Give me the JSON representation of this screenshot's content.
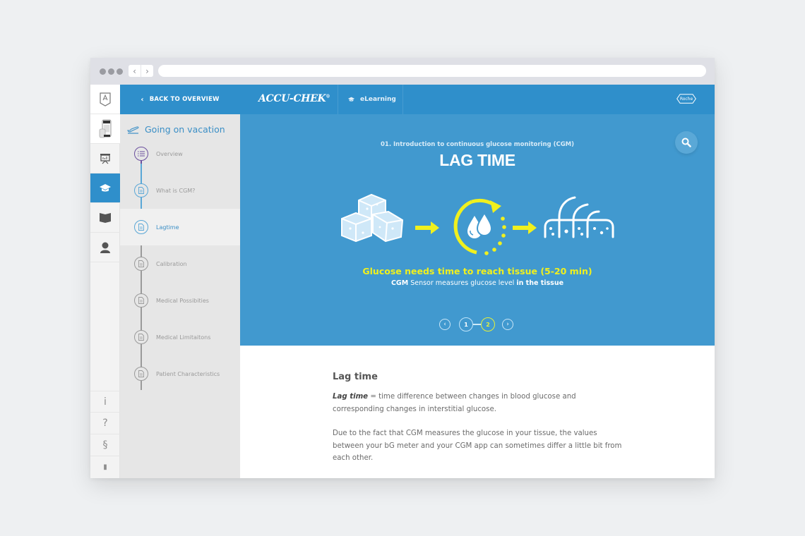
{
  "browser": {
    "back_glyph": "‹",
    "forward_glyph": "›",
    "url": ""
  },
  "rail": {
    "items": [
      {
        "name": "badge",
        "icon": "badge-icon"
      },
      {
        "name": "devices",
        "icon": "devices-icon"
      },
      {
        "name": "presentation",
        "icon": "presentation-icon"
      },
      {
        "name": "elearning",
        "icon": "graduation-cap-icon",
        "active": true
      },
      {
        "name": "book",
        "icon": "book-icon"
      },
      {
        "name": "profile",
        "icon": "user-icon"
      }
    ],
    "bottom": [
      {
        "name": "info",
        "glyph": "i"
      },
      {
        "name": "help",
        "glyph": "?"
      },
      {
        "name": "legal",
        "glyph": "§"
      },
      {
        "name": "logout",
        "glyph": "▮"
      }
    ]
  },
  "nav": {
    "back_label": "BACK TO OVERVIEW",
    "course_title": "Going on vacation",
    "items": [
      {
        "label": "Overview",
        "state": "current"
      },
      {
        "label": "What is CGM?",
        "state": "done"
      },
      {
        "label": "Lagtime",
        "state": "active"
      },
      {
        "label": "Calibration",
        "state": "todo"
      },
      {
        "label": "Medical Possibities",
        "state": "todo"
      },
      {
        "label": "Medical Limitaitons",
        "state": "todo"
      },
      {
        "label": "Patient Characteristics",
        "state": "todo"
      }
    ]
  },
  "header": {
    "brand": "ACCU-CHEK",
    "brand_mark": "®",
    "section": "eLearning",
    "partner": "Roche"
  },
  "hero": {
    "subtitle": "01. Introduction to continuous glucose monitoring (CGM)",
    "title": "LAG TIME",
    "caption_main": "Glucose needs time to reach tissue (5-20 min)",
    "caption_sub_bold1": "CGM",
    "caption_sub_text": " Sensor measures glucose level ",
    "caption_sub_bold2": "in the tissue",
    "pager": {
      "prev_glyph": "‹",
      "next_glyph": "›",
      "pages": [
        "1",
        "2"
      ],
      "current": "2"
    },
    "colors": {
      "accent": "#f0f01e",
      "background": "#4199cf"
    }
  },
  "content": {
    "heading": "Lag time",
    "term": "Lag time",
    "definition": " = time difference between changes in blood glucose and corresponding changes in interstitial glucose.",
    "paragraph2": "Due to the fact that CGM measures the glucose in your tissue, the values between your bG meter and your CGM app can sometimes differ a little bit from each other."
  },
  "colors": {
    "brand_blue": "#2f8fcb",
    "hero_blue": "#4199cf",
    "nav_active": "#3b8fc6",
    "yellow": "#f0f01e"
  }
}
